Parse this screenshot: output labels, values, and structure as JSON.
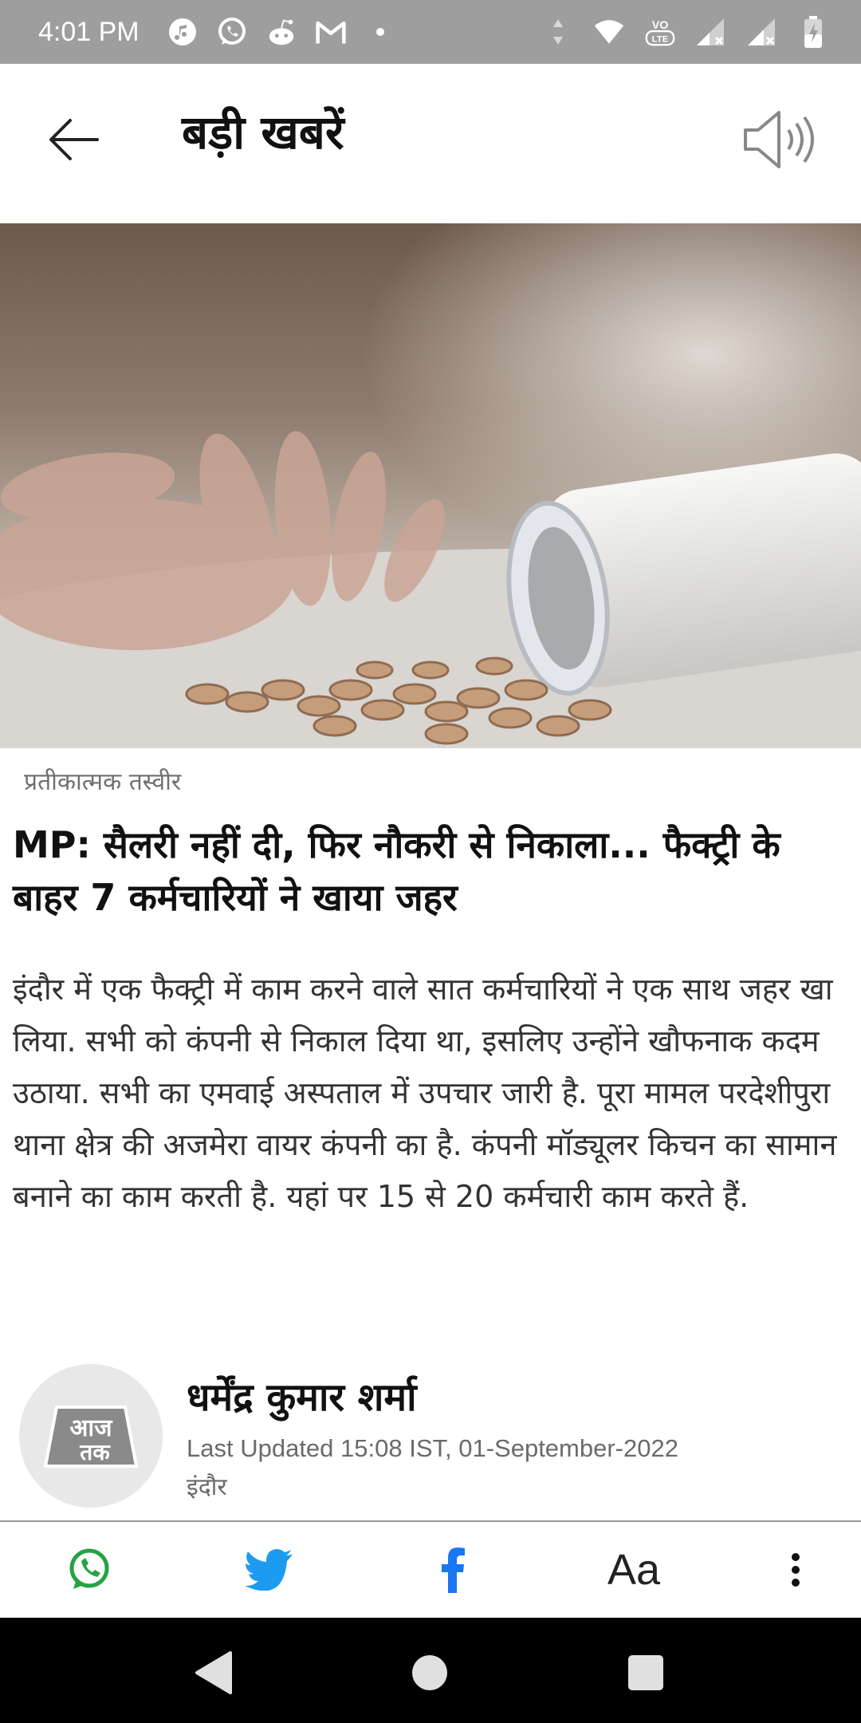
{
  "status_bar": {
    "time": "4:01 PM",
    "left_icons": [
      "music-icon",
      "whatsapp-icon",
      "reddit-icon",
      "gmail-icon",
      "dot-icon"
    ],
    "right_icons": [
      "data-arrows-icon",
      "wifi-icon",
      "volte-icon",
      "signal-1-icon",
      "signal-2-icon",
      "battery-charging-icon"
    ],
    "volte_label": "Vo LTE"
  },
  "app_bar": {
    "title": "बड़ी खबरें",
    "back_icon": "arrow-left-icon",
    "speaker_icon": "speaker-icon"
  },
  "article": {
    "image_caption": "प्रतीकात्मक तस्वीर",
    "headline": "MP: सैलरी नहीं दी, फिर नौकरी से निकाला... फैक्ट्री के बाहर 7 कर्मचारियों ने खाया जहर",
    "summary": "इंदौर में एक फैक्ट्री में काम करने वाले सात कर्मचारियों ने एक साथ जहर खा लिया. सभी को कंपनी से निकाल दिया था, इसलिए उन्होंने खौफनाक कदम उठाया. सभी का एमवाई अस्पताल में उपचार जारी है. पूरा मामल परदेशीपुरा थाना क्षेत्र की अजमेरा वायर कंपनी का है. कंपनी मॉड्यूलर किचन का सामान बनाने का काम करती है. यहां पर 15 से 20 कर्मचारी काम करते हैं."
  },
  "author": {
    "logo_text": "आज तक",
    "name": "धर्मेंद्र कुमार शर्मा",
    "updated": "Last Updated 15:08 IST, 01-September-2022",
    "location": "इंदौर"
  },
  "toolbar": {
    "font_size_label": "Aa",
    "items": [
      "whatsapp-icon",
      "twitter-icon",
      "facebook-icon",
      "font-size",
      "more-vertical-icon"
    ]
  },
  "colors": {
    "status_bar": "#9e9e9e",
    "whatsapp": "#25a244",
    "twitter": "#1d9bf0",
    "facebook": "#1877f2",
    "nav_bar": "#000000"
  }
}
